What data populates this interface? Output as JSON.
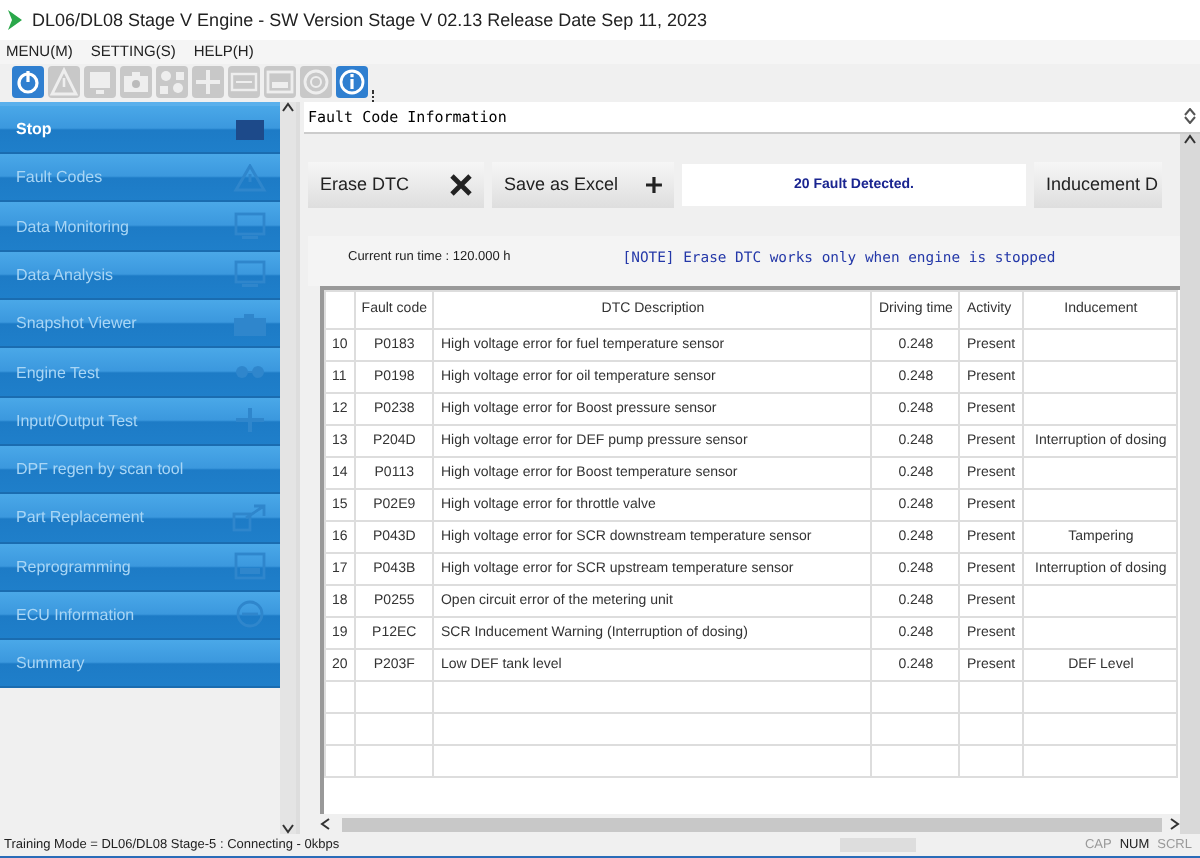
{
  "window": {
    "title": "DL06/DL08 Stage V Engine - SW Version Stage V 02.13 Release Date Sep 11, 2023"
  },
  "menu": [
    {
      "label": "MENU(M)"
    },
    {
      "label": "SETTING(S)"
    },
    {
      "label": "HELP(H)"
    }
  ],
  "toolbar": [
    {
      "disabled": false
    },
    {
      "disabled": true
    },
    {
      "disabled": true
    },
    {
      "disabled": true
    },
    {
      "disabled": true
    },
    {
      "disabled": true
    },
    {
      "disabled": true
    },
    {
      "disabled": true
    },
    {
      "disabled": true
    },
    {
      "disabled": false
    }
  ],
  "sidebar": {
    "items": [
      {
        "label": "Stop",
        "disabled": false
      },
      {
        "label": "Fault Codes",
        "disabled": true
      },
      {
        "label": "Data Monitoring",
        "disabled": true
      },
      {
        "label": "Data Analysis",
        "disabled": true
      },
      {
        "label": "Snapshot Viewer",
        "disabled": true
      },
      {
        "label": "Engine Test",
        "disabled": true
      },
      {
        "label": "Input/Output Test",
        "disabled": true
      },
      {
        "label": "DPF regen by scan tool",
        "disabled": true
      },
      {
        "label": "Part Replacement",
        "disabled": true
      },
      {
        "label": "Reprogramming",
        "disabled": true
      },
      {
        "label": "ECU Information",
        "disabled": true
      },
      {
        "label": "Summary",
        "disabled": true
      }
    ]
  },
  "panel": {
    "title": "Fault Code Information",
    "buttons": [
      {
        "label": "Erase DTC",
        "kind": "erase"
      },
      {
        "label": "Save as Excel",
        "kind": "save"
      }
    ],
    "message": "20 Fault Detected.",
    "cut_button": "Inducement D",
    "run_time": "Current run time : 120.000 h",
    "note": "[NOTE] Erase DTC works only when engine is stopped",
    "table": {
      "columns": [
        "",
        "Fault code",
        "DTC Description",
        "Driving time",
        "Activity",
        "Inducement"
      ],
      "rows": [
        [
          "10",
          "P0183",
          "High voltage error for fuel temperature sensor",
          "0.248",
          "Present",
          ""
        ],
        [
          "11",
          "P0198",
          "High voltage error for oil temperature sensor",
          "0.248",
          "Present",
          ""
        ],
        [
          "12",
          "P0238",
          "High voltage error for Boost pressure sensor",
          "0.248",
          "Present",
          ""
        ],
        [
          "13",
          "P204D",
          "High voltage error for DEF pump pressure sensor",
          "0.248",
          "Present",
          "Interruption of dosing"
        ],
        [
          "14",
          "P0113",
          "High voltage error for Boost temperature sensor",
          "0.248",
          "Present",
          ""
        ],
        [
          "15",
          "P02E9",
          "High voltage error for throttle valve",
          "0.248",
          "Present",
          ""
        ],
        [
          "16",
          "P043D",
          "High voltage error for SCR downstream temperature sensor",
          "0.248",
          "Present",
          "Tampering"
        ],
        [
          "17",
          "P043B",
          "High voltage error for SCR upstream temperature sensor",
          "0.248",
          "Present",
          "Interruption of dosing"
        ],
        [
          "18",
          "P0255",
          "Open circuit error of the metering unit",
          "0.248",
          "Present",
          ""
        ],
        [
          "19",
          "P12EC",
          "SCR Inducement Warning (Interruption of dosing)",
          "0.248",
          "Present",
          ""
        ],
        [
          "20",
          "P203F",
          "Low DEF tank level",
          "0.248",
          "Present",
          "DEF Level"
        ]
      ]
    }
  },
  "status_bar": {
    "text": "Training Mode = DL06/DL08 Stage-5 : Connecting - 0kbps",
    "indicators": [
      {
        "label": "CAP",
        "on": false
      },
      {
        "label": "NUM",
        "on": true
      },
      {
        "label": "SCRL",
        "on": false
      }
    ]
  }
}
